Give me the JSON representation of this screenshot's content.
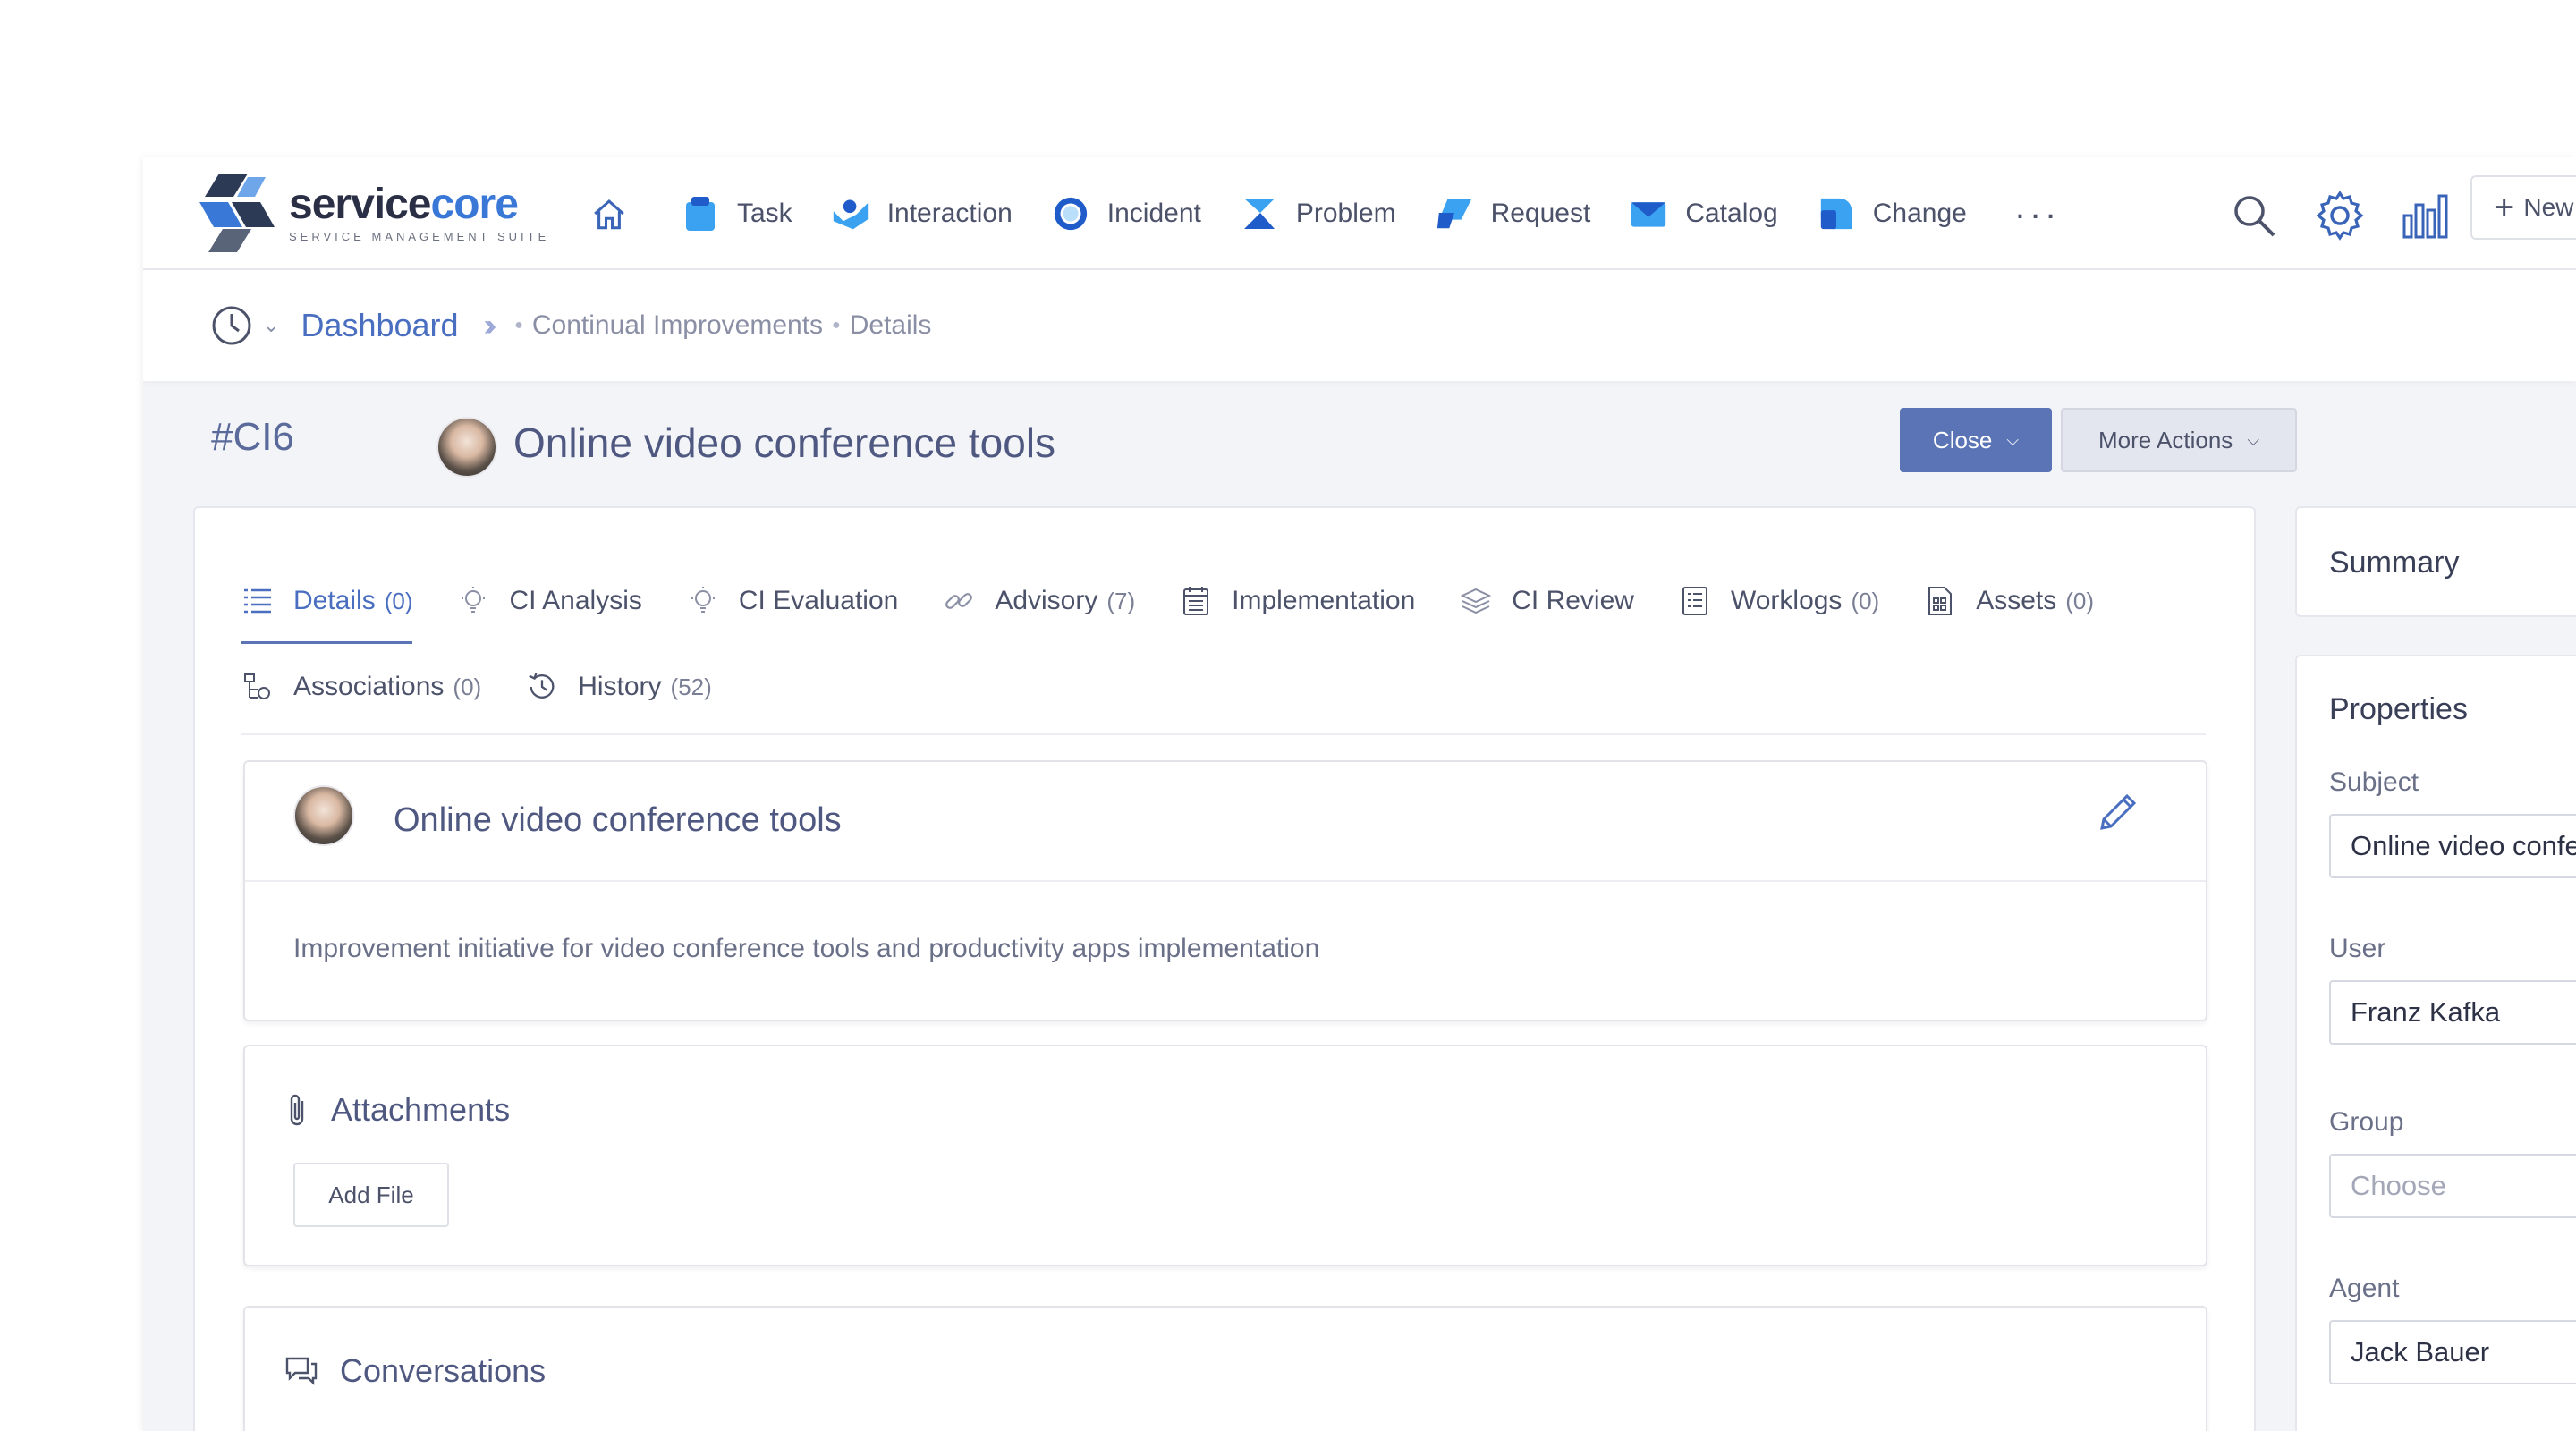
{
  "brand": {
    "name_a": "service",
    "name_b": "core",
    "tagline": "SERVICE MANAGEMENT SUITE"
  },
  "nav": {
    "modules": [
      {
        "label": "Task",
        "icon": "task-icon"
      },
      {
        "label": "Interaction",
        "icon": "interaction-icon"
      },
      {
        "label": "Incident",
        "icon": "incident-icon"
      },
      {
        "label": "Problem",
        "icon": "problem-icon"
      },
      {
        "label": "Request",
        "icon": "request-icon"
      },
      {
        "label": "Catalog",
        "icon": "catalog-icon"
      },
      {
        "label": "Change",
        "icon": "change-icon"
      }
    ],
    "more": "...",
    "new_label": "New"
  },
  "breadcrumb": {
    "home": "Dashboard",
    "items": [
      "Continual Improvements",
      "Details"
    ]
  },
  "ticket": {
    "id": "#CI6",
    "title": "Online video conference tools",
    "close_label": "Close",
    "more_actions_label": "More Actions"
  },
  "tabs": {
    "row1": [
      {
        "label": "Details",
        "count": "(0)",
        "active": true
      },
      {
        "label": "CI Analysis",
        "count": ""
      },
      {
        "label": "CI Evaluation",
        "count": ""
      },
      {
        "label": "Advisory",
        "count": "(7)"
      },
      {
        "label": "Implementation",
        "count": ""
      },
      {
        "label": "CI Review",
        "count": ""
      },
      {
        "label": "Worklogs",
        "count": "(0)"
      },
      {
        "label": "Assets",
        "count": "(0)"
      }
    ],
    "row2": [
      {
        "label": "Associations",
        "count": "(0)"
      },
      {
        "label": "History",
        "count": "(52)"
      }
    ]
  },
  "details": {
    "title": "Online video conference tools",
    "description": "Improvement initiative for video conference tools and productivity apps implementation"
  },
  "attachments": {
    "title": "Attachments",
    "add_file": "Add File"
  },
  "conversations": {
    "title": "Conversations"
  },
  "summary": {
    "title": "Summary"
  },
  "properties": {
    "title": "Properties",
    "subject_label": "Subject",
    "subject_value": "Online video conference tools",
    "user_label": "User",
    "user_value": "Franz Kafka",
    "group_label": "Group",
    "group_placeholder": "Choose",
    "agent_label": "Agent",
    "agent_value": "Jack Bauer"
  },
  "colors": {
    "accent": "#5a74b5",
    "link": "#4a6fc0",
    "brand_blue": "#3a78d8"
  }
}
